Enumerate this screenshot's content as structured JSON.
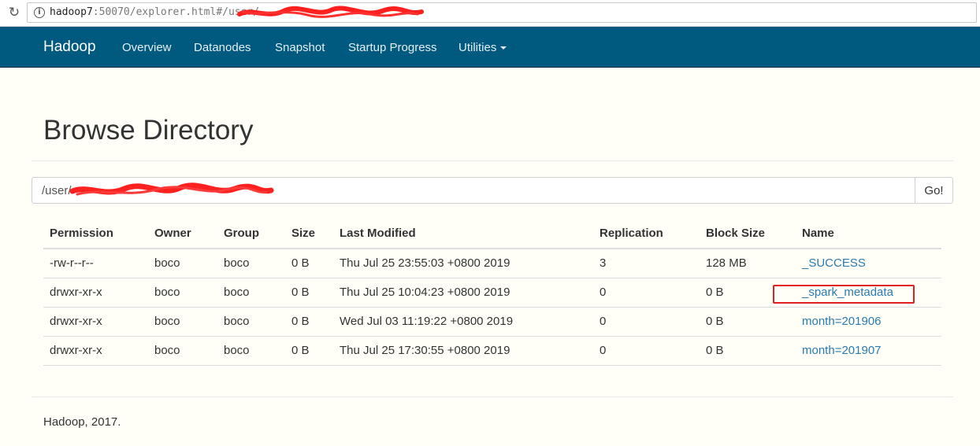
{
  "browser": {
    "url_host": "hadoop7",
    "url_rest": ":50070/explorer.html#/user/"
  },
  "navbar": {
    "brand": "Hadoop",
    "items": [
      {
        "label": "Overview"
      },
      {
        "label": "Datanodes"
      },
      {
        "label": "Snapshot"
      },
      {
        "label": "Startup Progress"
      },
      {
        "label": "Utilities"
      }
    ]
  },
  "page": {
    "title": "Browse Directory"
  },
  "path": {
    "value": "/user/",
    "go_label": "Go!"
  },
  "table": {
    "headers": [
      "Permission",
      "Owner",
      "Group",
      "Size",
      "Last Modified",
      "Replication",
      "Block Size",
      "Name"
    ],
    "rows": [
      {
        "permission": "-rw-r--r--",
        "owner": "boco",
        "group": "boco",
        "size": "0 B",
        "modified": "Thu Jul 25 23:55:03 +0800 2019",
        "replication": "3",
        "block_size": "128 MB",
        "name": "_SUCCESS"
      },
      {
        "permission": "drwxr-xr-x",
        "owner": "boco",
        "group": "boco",
        "size": "0 B",
        "modified": "Thu Jul 25 10:04:23 +0800 2019",
        "replication": "0",
        "block_size": "0 B",
        "name": "_spark_metadata"
      },
      {
        "permission": "drwxr-xr-x",
        "owner": "boco",
        "group": "boco",
        "size": "0 B",
        "modified": "Wed Jul 03 11:19:22 +0800 2019",
        "replication": "0",
        "block_size": "0 B",
        "name": "month=201906"
      },
      {
        "permission": "drwxr-xr-x",
        "owner": "boco",
        "group": "boco",
        "size": "0 B",
        "modified": "Thu Jul 25 17:30:55 +0800 2019",
        "replication": "0",
        "block_size": "0 B",
        "name": "month=201907"
      }
    ]
  },
  "footer": {
    "text": "Hadoop, 2017."
  },
  "colors": {
    "navbar": "#005a7f",
    "link": "#2a7ab0",
    "highlight": "#e02020",
    "redaction": "#ff2020"
  }
}
